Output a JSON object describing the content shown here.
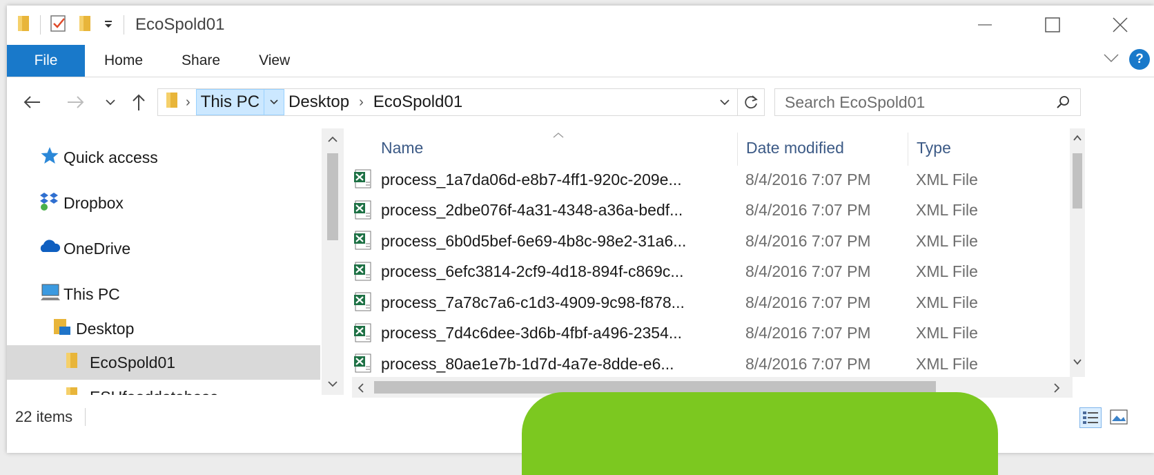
{
  "window": {
    "title": "EcoSpold01"
  },
  "ribbon": {
    "tabs": [
      "File",
      "Home",
      "Share",
      "View"
    ]
  },
  "address": {
    "crumbs": [
      "This PC",
      "Desktop",
      "EcoSpold01"
    ]
  },
  "search": {
    "placeholder": "Search EcoSpold01"
  },
  "nav_pane": {
    "items": [
      {
        "label": "Quick access",
        "icon": "star-icon"
      },
      {
        "label": "Dropbox",
        "icon": "dropbox-icon"
      },
      {
        "label": "OneDrive",
        "icon": "onedrive-cloud-icon"
      },
      {
        "label": "This PC",
        "icon": "computer-icon"
      },
      {
        "label": "Desktop",
        "icon": "desktop-folder-icon"
      },
      {
        "label": "EcoSpold01",
        "icon": "folder-icon"
      },
      {
        "label": "ESUfooddatabase",
        "icon": "folder-icon"
      }
    ]
  },
  "columns": {
    "name": "Name",
    "date": "Date modified",
    "type": "Type"
  },
  "files": [
    {
      "name": "process_1a7da06d-e8b7-4ff1-920c-209e...",
      "date": "8/4/2016 7:07 PM",
      "type": "XML File"
    },
    {
      "name": "process_2dbe076f-4a31-4348-a36a-bedf...",
      "date": "8/4/2016 7:07 PM",
      "type": "XML File"
    },
    {
      "name": "process_6b0d5bef-6e69-4b8c-98e2-31a6...",
      "date": "8/4/2016 7:07 PM",
      "type": "XML File"
    },
    {
      "name": "process_6efc3814-2cf9-4d18-894f-c869c...",
      "date": "8/4/2016 7:07 PM",
      "type": "XML File"
    },
    {
      "name": "process_7a78c7a6-c1d3-4909-9c98-f878...",
      "date": "8/4/2016 7:07 PM",
      "type": "XML File"
    },
    {
      "name": "process_7d4c6dee-3d6b-4fbf-a496-2354...",
      "date": "8/4/2016 7:07 PM",
      "type": "XML File"
    },
    {
      "name": "process_80ae1e7b-1d7d-4a7e-8dde-e6...",
      "date": "8/4/2016 7:07 PM",
      "type": "XML File"
    }
  ],
  "status": {
    "item_count": "22 items"
  },
  "colors": {
    "file_tab": "#1979ca",
    "selection": "#cce8ff",
    "nav_selected": "#d9d9d9",
    "green_overlay": "#7cc820"
  }
}
